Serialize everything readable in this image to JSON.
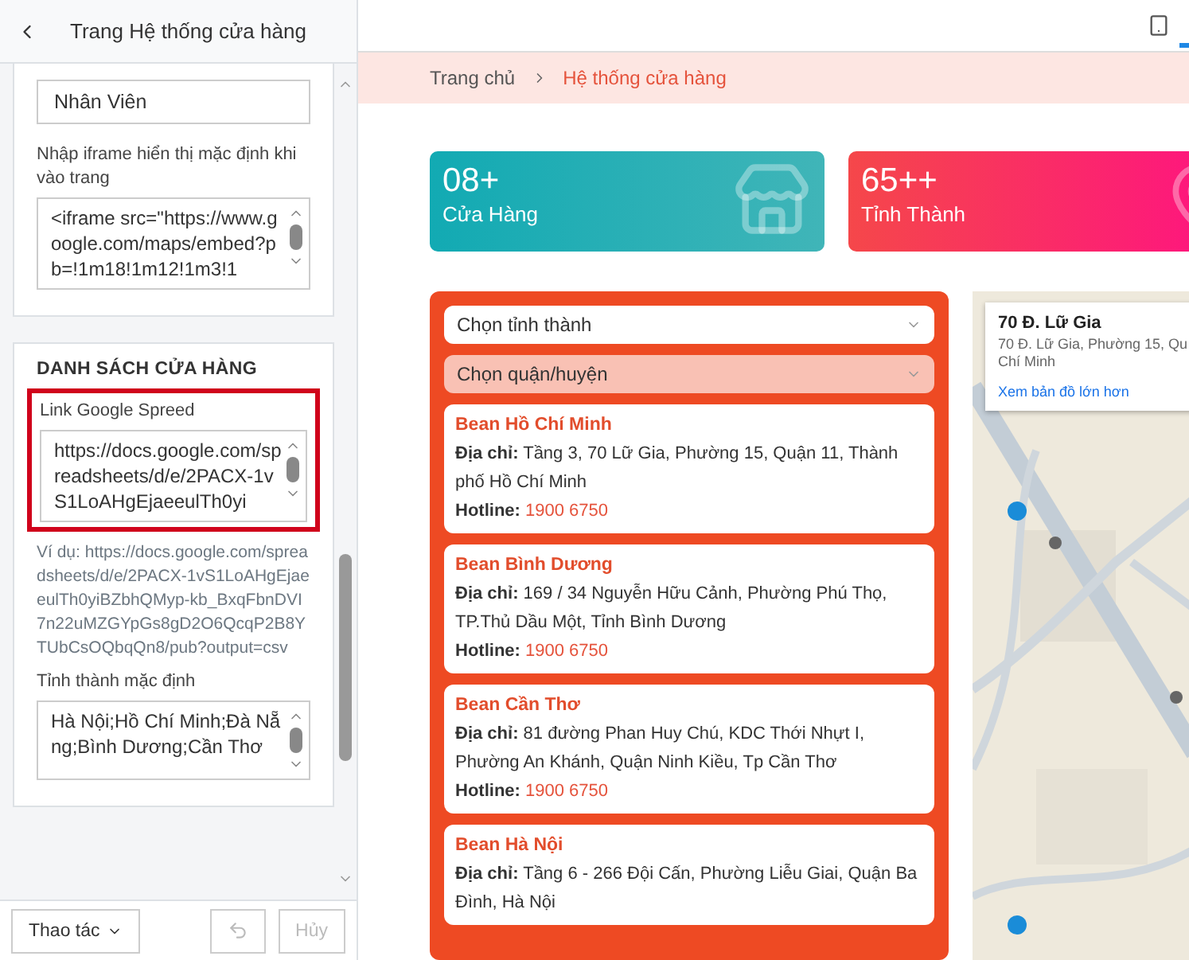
{
  "editor": {
    "title": "Trang Hệ thống cửa hàng",
    "sections": [
      {
        "fields": [
          {
            "kind": "input",
            "value": "Nhân Viên"
          },
          {
            "kind": "textarea",
            "label": "Nhập iframe hiển thị mặc định khi vào trang",
            "value": "<iframe src=\"https://www.google.com/maps/embed?pb=!1m18!1m12!1m3!1"
          }
        ]
      },
      {
        "heading": "DANH SÁCH CỬA HÀNG",
        "fields": [
          {
            "kind": "textarea",
            "label": "Link Google Spreed",
            "value": "https://docs.google.com/spreadsheets/d/e/2PACX-1vS1LoAHgEjaeeulTh0yi",
            "highlighted": true,
            "hint": "Ví dụ: https://docs.google.com/spreadsheets/d/e/2PACX-1vS1LoAHgEjaeeulTh0yiBZbhQMyp-kb_BxqFbnDVI7n22uMZGYpGs8gD2O6QcqP2B8YTUbCsOQbqQn8/pub?output=csv"
          },
          {
            "kind": "textarea",
            "label": "Tỉnh thành mặc định",
            "value": "Hà Nội;Hồ Chí Minh;Đà Nẵng;Bình Dương;Cần Thơ"
          }
        ]
      }
    ]
  },
  "footer": {
    "actions": "Thao tác",
    "undo_disabled": true,
    "cancel": {
      "label": "Hủy",
      "disabled": true
    }
  },
  "preview": {
    "breadcrumb": [
      {
        "label": "Trang chủ",
        "selected": false
      },
      {
        "label": "Hệ thống cửa hàng",
        "selected": true
      }
    ],
    "stats": [
      {
        "kind": "store",
        "value": "08+",
        "label": "Cửa Hàng"
      },
      {
        "kind": "pin",
        "value": "65++",
        "label": "Tỉnh Thành"
      }
    ],
    "filters": [
      {
        "placeholder": "Chọn tỉnh thành",
        "disabled": false
      },
      {
        "placeholder": "Chọn quận/huyện",
        "disabled": true
      }
    ],
    "stores": [
      {
        "name": "Bean Hồ Chí Minh",
        "address_label": "Địa chỉ:",
        "address": "Tầng 3, 70 Lữ Gia, Phường 15, Quận 11, Thành phố Hồ Chí Minh",
        "hotline_label": "Hotline:",
        "hotline": "1900 6750"
      },
      {
        "name": "Bean Bình Dương",
        "address_label": "Địa chỉ:",
        "address": "169 / 34 Nguyễn Hữu Cảnh, Phường Phú Thọ, TP.Thủ Dầu Một, Tỉnh Bình Dương",
        "hotline_label": "Hotline:",
        "hotline": "1900 6750"
      },
      {
        "name": "Bean Cần Thơ",
        "address_label": "Địa chỉ:",
        "address": "81 đường Phan Huy Chú, KDC Thới Nhựt I, Phường An Khánh, Quận Ninh Kiều, Tp Cần Thơ",
        "hotline_label": "Hotline:",
        "hotline": "1900 6750"
      },
      {
        "name": "Bean Hà Nội",
        "address_label": "Địa chỉ:",
        "address": "Tầng 6 - 266 Đội Cấn, Phường Liễu Giai, Quận Ba Đình, Hà Nội"
      }
    ],
    "map": {
      "kind": "picture",
      "place_title": "70 Đ. Lữ Gia",
      "place_address_lines": [
        "70 Đ. Lữ Gia, Phường 15, Qu",
        "Chí Minh"
      ],
      "link": "Xem bản đồ lớn hơn"
    }
  }
}
